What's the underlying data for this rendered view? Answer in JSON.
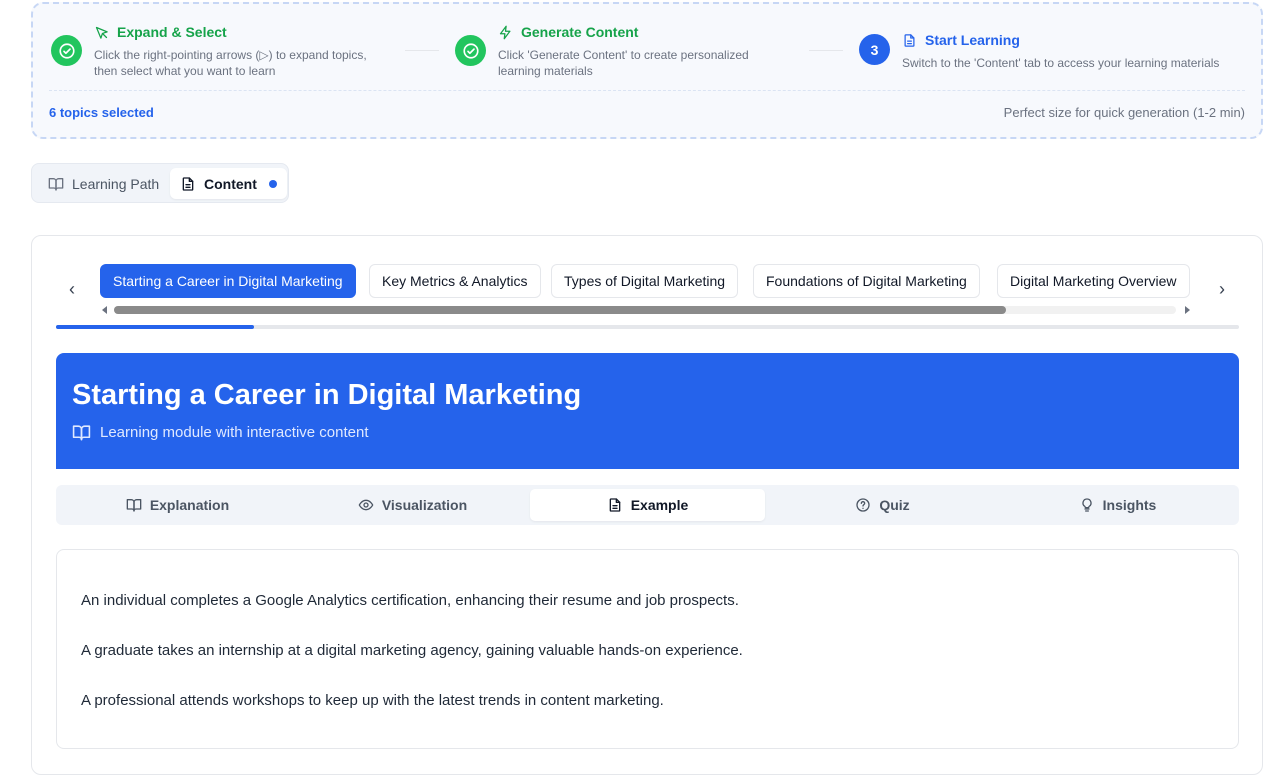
{
  "steps": [
    {
      "status": "done",
      "title": "Expand & Select",
      "description": [
        "Click the right-pointing arrows (▷) to expand topics,",
        "then select what you want to learn"
      ]
    },
    {
      "status": "done",
      "title": "Generate Content",
      "description": [
        "Click 'Generate Content' to create personalized",
        "learning materials"
      ]
    },
    {
      "status": "current",
      "number": "3",
      "title": "Start Learning",
      "description": [
        "Switch to the 'Content' tab to access your learning materials"
      ]
    }
  ],
  "selection": {
    "count_text": "6 topics selected",
    "note": "Perfect size for quick generation (1-2 min)"
  },
  "main_tabs": {
    "learning_path": "Learning Path",
    "content": "Content"
  },
  "topics": {
    "items": [
      "Starting a Career in Digital Marketing",
      "Key Metrics & Analytics",
      "Types of Digital Marketing",
      "Foundations of Digital Marketing",
      "Digital Marketing Overview"
    ],
    "active_index": 0,
    "progress_fraction": 0.167,
    "prev_arrow": "‹",
    "next_arrow": "›"
  },
  "module": {
    "title": "Starting a Career in Digital Marketing",
    "subtitle": "Learning module with interactive content"
  },
  "sub_tabs": {
    "explanation": "Explanation",
    "visualization": "Visualization",
    "example": "Example",
    "quiz": "Quiz",
    "insights": "Insights",
    "active": "example"
  },
  "examples": [
    "An individual completes a Google Analytics certification, enhancing their resume and job prospects.",
    "A graduate takes an internship at a digital marketing agency, gaining valuable hands-on experience.",
    "A professional attends workshops to keep up with the latest trends in content marketing."
  ],
  "colors": {
    "primary": "#2563eb",
    "success": "#22c55e",
    "success_text": "#16a34a"
  }
}
